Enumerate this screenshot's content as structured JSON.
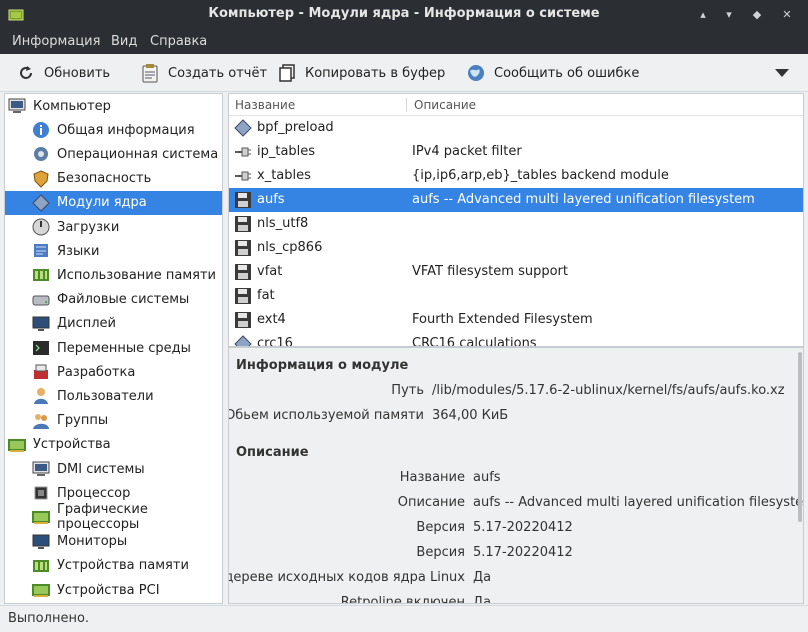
{
  "window": {
    "title": "Компьютер - Модули ядра - Информация о системе",
    "buttons": [
      "minimize",
      "maximize",
      "close"
    ]
  },
  "menu": [
    "Информация",
    "Вид",
    "Справка"
  ],
  "toolbar": {
    "refresh": "Обновить",
    "report": "Создать отчёт",
    "copy": "Копировать в буфер",
    "bug": "Сообщить об ошибке"
  },
  "sidebar": {
    "items": [
      {
        "label": "Компьютер",
        "icon": "computer-icon",
        "level": 0
      },
      {
        "label": "Общая информация",
        "icon": "info-icon",
        "level": 1
      },
      {
        "label": "Операционная система",
        "icon": "gear-icon",
        "level": 1
      },
      {
        "label": "Безопасность",
        "icon": "shield-icon",
        "level": 1
      },
      {
        "label": "Модули ядра",
        "icon": "module-icon",
        "level": 1,
        "selected": true
      },
      {
        "label": "Загрузки",
        "icon": "power-icon",
        "level": 1
      },
      {
        "label": "Языки",
        "icon": "flag-icon",
        "level": 1
      },
      {
        "label": "Использование памяти",
        "icon": "memory-icon",
        "level": 1
      },
      {
        "label": "Файловые системы",
        "icon": "drive-icon",
        "level": 1
      },
      {
        "label": "Дисплей",
        "icon": "display-icon",
        "level": 1
      },
      {
        "label": "Переменные среды",
        "icon": "terminal-icon",
        "level": 1
      },
      {
        "label": "Разработка",
        "icon": "devel-icon",
        "level": 1
      },
      {
        "label": "Пользователи",
        "icon": "user-icon",
        "level": 1
      },
      {
        "label": "Группы",
        "icon": "group-icon",
        "level": 1
      },
      {
        "label": "Устройства",
        "icon": "board-icon",
        "level": 0
      },
      {
        "label": "DMI системы",
        "icon": "computer-icon",
        "level": 1
      },
      {
        "label": "Процессор",
        "icon": "cpu-icon",
        "level": 1
      },
      {
        "label": "Графические процессоры",
        "icon": "board-icon",
        "level": 1
      },
      {
        "label": "Мониторы",
        "icon": "display-icon",
        "level": 1
      },
      {
        "label": "Устройства памяти",
        "icon": "memory-icon",
        "level": 1
      },
      {
        "label": "Устройства PCI",
        "icon": "board-icon",
        "level": 1
      }
    ]
  },
  "modules": {
    "headers": {
      "name": "Название",
      "description": "Описание"
    },
    "rows": [
      {
        "name": "bpf_preload",
        "description": "",
        "icon": "module-icon"
      },
      {
        "name": "ip_tables",
        "description": "IPv4 packet filter",
        "icon": "plug-icon"
      },
      {
        "name": "x_tables",
        "description": "{ip,ip6,arp,eb}_tables backend module",
        "icon": "plug-icon"
      },
      {
        "name": "aufs",
        "description": "aufs -- Advanced multi layered unification filesystem",
        "icon": "floppy-icon",
        "selected": true
      },
      {
        "name": "nls_utf8",
        "description": "",
        "icon": "floppy-icon"
      },
      {
        "name": "nls_cp866",
        "description": "",
        "icon": "floppy-icon"
      },
      {
        "name": "vfat",
        "description": "VFAT filesystem support",
        "icon": "floppy-icon"
      },
      {
        "name": "fat",
        "description": "",
        "icon": "floppy-icon"
      },
      {
        "name": "ext4",
        "description": "Fourth Extended Filesystem",
        "icon": "floppy-icon"
      },
      {
        "name": "crc16",
        "description": "CRC16 calculations",
        "icon": "module-icon"
      }
    ]
  },
  "details": {
    "module_info_title": "Информация о модуле",
    "path_label": "Путь",
    "path_value": "/lib/modules/5.17.6-2-ublinux/kernel/fs/aufs/aufs.ko.xz",
    "mem_label": "Обьем используемой памяти",
    "mem_value": "364,00 КиБ",
    "desc_title": "Описание",
    "fields": [
      {
        "label": "Название",
        "value": "aufs"
      },
      {
        "label": "Описание",
        "value": "aufs -- Advanced multi layered unification filesystem"
      },
      {
        "label": "Версия",
        "value": "5.17-20220412"
      },
      {
        "label": "Версия",
        "value": "5.17-20220412"
      },
      {
        "label": "В дереве исходных кодов ядра Linux",
        "value": "Да"
      },
      {
        "label": "Retpoline включен",
        "value": "Да"
      }
    ]
  },
  "status": "Выполнено.",
  "colors": {
    "selection": "#3584e4",
    "titlebar": "#2b2f34",
    "background": "#eef0f2"
  }
}
